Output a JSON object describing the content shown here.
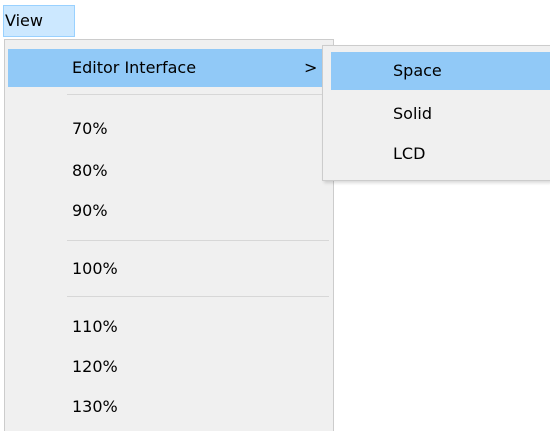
{
  "menubar": {
    "view_label": "View"
  },
  "menu": {
    "items": [
      {
        "label": "Editor Interface",
        "arrow": ">"
      },
      {
        "label": "70%"
      },
      {
        "label": "80%"
      },
      {
        "label": "90%"
      },
      {
        "label": "100%"
      },
      {
        "label": "110%"
      },
      {
        "label": "120%"
      },
      {
        "label": "130%"
      }
    ]
  },
  "submenu": {
    "items": [
      {
        "label": "Space"
      },
      {
        "label": "Solid"
      },
      {
        "label": "LCD"
      }
    ]
  },
  "colors": {
    "highlight": "#91c9f7",
    "menubar_active": "#cce8ff",
    "menu_background": "#f0f0f0"
  }
}
